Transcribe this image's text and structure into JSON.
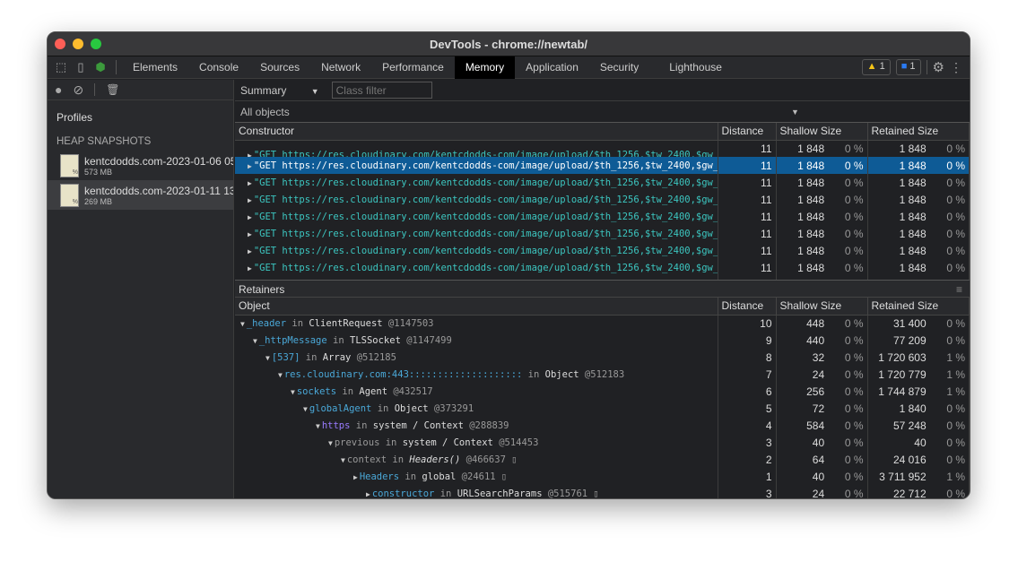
{
  "window": {
    "title": "DevTools - chrome://newtab/"
  },
  "tabs": [
    "Elements",
    "Console",
    "Sources",
    "Network",
    "Performance",
    "Memory",
    "Application",
    "Security",
    "Lighthouse"
  ],
  "active_tab": "Memory",
  "badges": {
    "warnings": "1",
    "messages": "1"
  },
  "sidebar": {
    "profiles_label": "Profiles",
    "section": "HEAP SNAPSHOTS",
    "snapshots": [
      {
        "name": "kentcdodds.com-2023-01-06 05",
        "size": "573 MB"
      },
      {
        "name": "kentcdodds.com-2023-01-11 13",
        "size": "269 MB"
      }
    ]
  },
  "toolbar": {
    "view": "Summary",
    "class_filter_placeholder": "Class filter",
    "scope": "All objects"
  },
  "constructors": {
    "headers": [
      "Constructor",
      "Distance",
      "Shallow Size",
      "Retained Size"
    ],
    "row_text": "\"GET https://res.cloudinary.com/kentcdodds-com/image/upload/$th_1256,$tw_2400,$gw_$tw_2400,$gw_",
    "rows": [
      {
        "distance": "11",
        "shallow": "1 848",
        "shallow_pct": "0 %",
        "retained": "1 848",
        "retained_pct": "0 %"
      }
    ],
    "row_count": 9,
    "selected_row": 1
  },
  "retainers": {
    "title": "Retainers",
    "headers": [
      "Object",
      "Distance",
      "Shallow Size",
      "Retained Size"
    ],
    "rows": [
      {
        "name": "_header",
        "color": "blue",
        "ctx": "ClientRequest",
        "id": "@1147503",
        "d": "10",
        "s": "448",
        "sp": "0 %",
        "r": "31 400",
        "rp": "0 %",
        "open": true
      },
      {
        "name": "_httpMessage",
        "color": "blue",
        "ctx": "TLSSocket",
        "id": "@1147499",
        "d": "9",
        "s": "440",
        "sp": "0 %",
        "r": "77 209",
        "rp": "0 %",
        "open": true
      },
      {
        "name": "[537]",
        "color": "blue",
        "ctx": "Array",
        "id": "@512185",
        "d": "8",
        "s": "32",
        "sp": "0 %",
        "r": "1 720 603",
        "rp": "1 %",
        "open": true
      },
      {
        "name": "res.cloudinary.com:443::::::::::::::::::::",
        "color": "blue",
        "ctx": "Object",
        "id": "@512183",
        "d": "7",
        "s": "24",
        "sp": "0 %",
        "r": "1 720 779",
        "rp": "1 %",
        "open": true
      },
      {
        "name": "sockets",
        "color": "blue",
        "ctx": "Agent",
        "id": "@432517",
        "d": "6",
        "s": "256",
        "sp": "0 %",
        "r": "1 744 879",
        "rp": "1 %",
        "open": true
      },
      {
        "name": "globalAgent",
        "color": "blue",
        "ctx": "Object",
        "id": "@373291",
        "d": "5",
        "s": "72",
        "sp": "0 %",
        "r": "1 840",
        "rp": "0 %",
        "open": true
      },
      {
        "name": "https",
        "color": "purple",
        "ctx": "system / Context",
        "id": "@288839",
        "d": "4",
        "s": "584",
        "sp": "0 %",
        "r": "57 248",
        "rp": "0 %",
        "open": true
      },
      {
        "name": "previous",
        "color": "grey",
        "ctx": "system / Context",
        "id": "@514453",
        "d": "3",
        "s": "40",
        "sp": "0 %",
        "r": "40",
        "rp": "0 %",
        "open": true
      },
      {
        "name": "context",
        "color": "grey",
        "ctx": "Headers()",
        "id": "@466637 ▯",
        "d": "2",
        "s": "64",
        "sp": "0 %",
        "r": "24 016",
        "rp": "0 %",
        "open": true,
        "italic": true
      },
      {
        "name": "Headers",
        "color": "blue",
        "ctx": "global",
        "id": "@24611 ▯",
        "d": "1",
        "s": "40",
        "sp": "0 %",
        "r": "3 711 952",
        "rp": "1 %",
        "open": false
      },
      {
        "name": "constructor",
        "color": "blue",
        "ctx": "URLSearchParams",
        "id": "@515761 ▯",
        "d": "3",
        "s": "24",
        "sp": "0 %",
        "r": "22 712",
        "rp": "0 %",
        "open": false
      }
    ],
    "in_label": "in"
  }
}
